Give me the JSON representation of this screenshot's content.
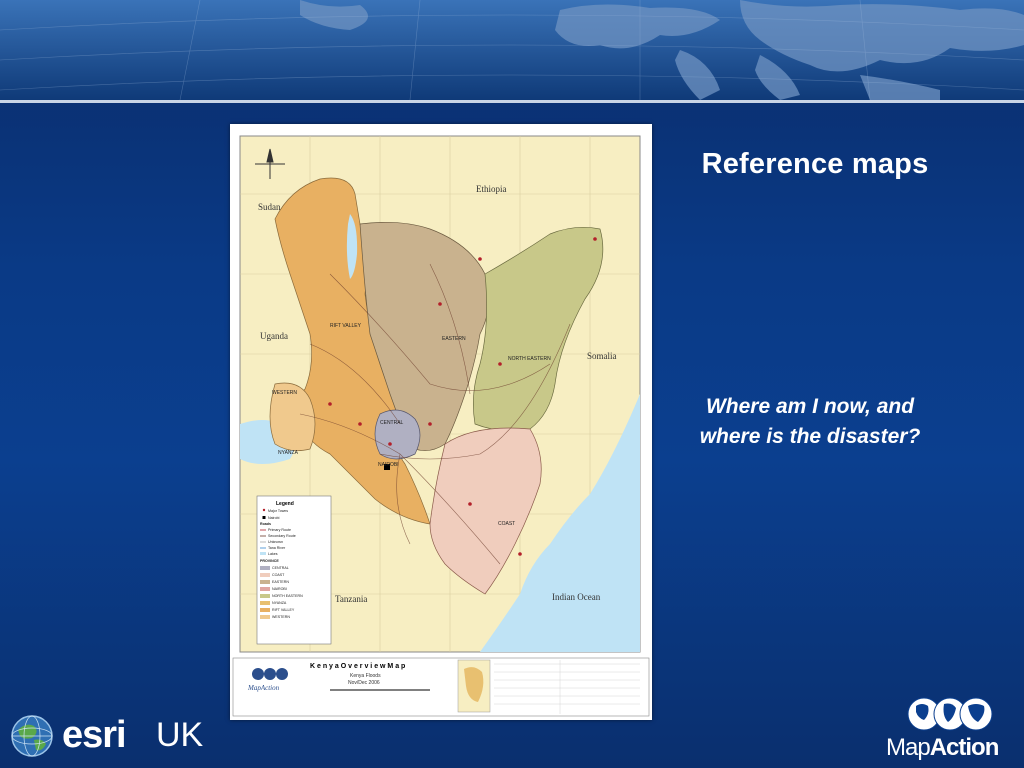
{
  "slide": {
    "title": "Reference maps",
    "subtitle_line1": "Where am I now, and",
    "subtitle_line2": "where is the disaster?"
  },
  "logos": {
    "esri_word": "esri",
    "esri_region": "UK",
    "mapaction_part1": "Map",
    "mapaction_part2": "Action"
  },
  "map": {
    "countries": [
      "Sudan",
      "Ethiopia",
      "Uganda",
      "Somalia",
      "Tanzania"
    ],
    "ocean": "Indian Ocean",
    "provinces": [
      "RIFT VALLEY",
      "EASTERN",
      "NORTH EASTERN",
      "WESTERN",
      "NYANZA",
      "CENTRAL",
      "NAIROBI",
      "COAST"
    ],
    "legend_title": "Legend",
    "legend_items": [
      "Major Towns",
      "Nairobi",
      "Roads",
      "Primary Route",
      "Secondary Route",
      "Unknown",
      "Tana River",
      "Lakes",
      "PROVINCE",
      "CENTRAL",
      "COAST",
      "EASTERN",
      "NAIROBI",
      "NORTH EASTERN",
      "NYANZA",
      "RIFT VALLEY",
      "WESTERN"
    ],
    "footer_title": "K e n y a   O v e r v i e w   M a p",
    "footer_sub1": "Kenya Floods",
    "footer_sub2": "Nov/Dec 2006",
    "footer_logo": "MapAction"
  },
  "colors": {
    "background": "#0b3f8f",
    "rift_valley": "#e8b062",
    "eastern": "#c9b28e",
    "north_eastern": "#c8c889",
    "coast": "#f0cdbd",
    "central": "#b0b0c2",
    "ocean": "#bfe3f5",
    "land_outside": "#f7eec2"
  }
}
